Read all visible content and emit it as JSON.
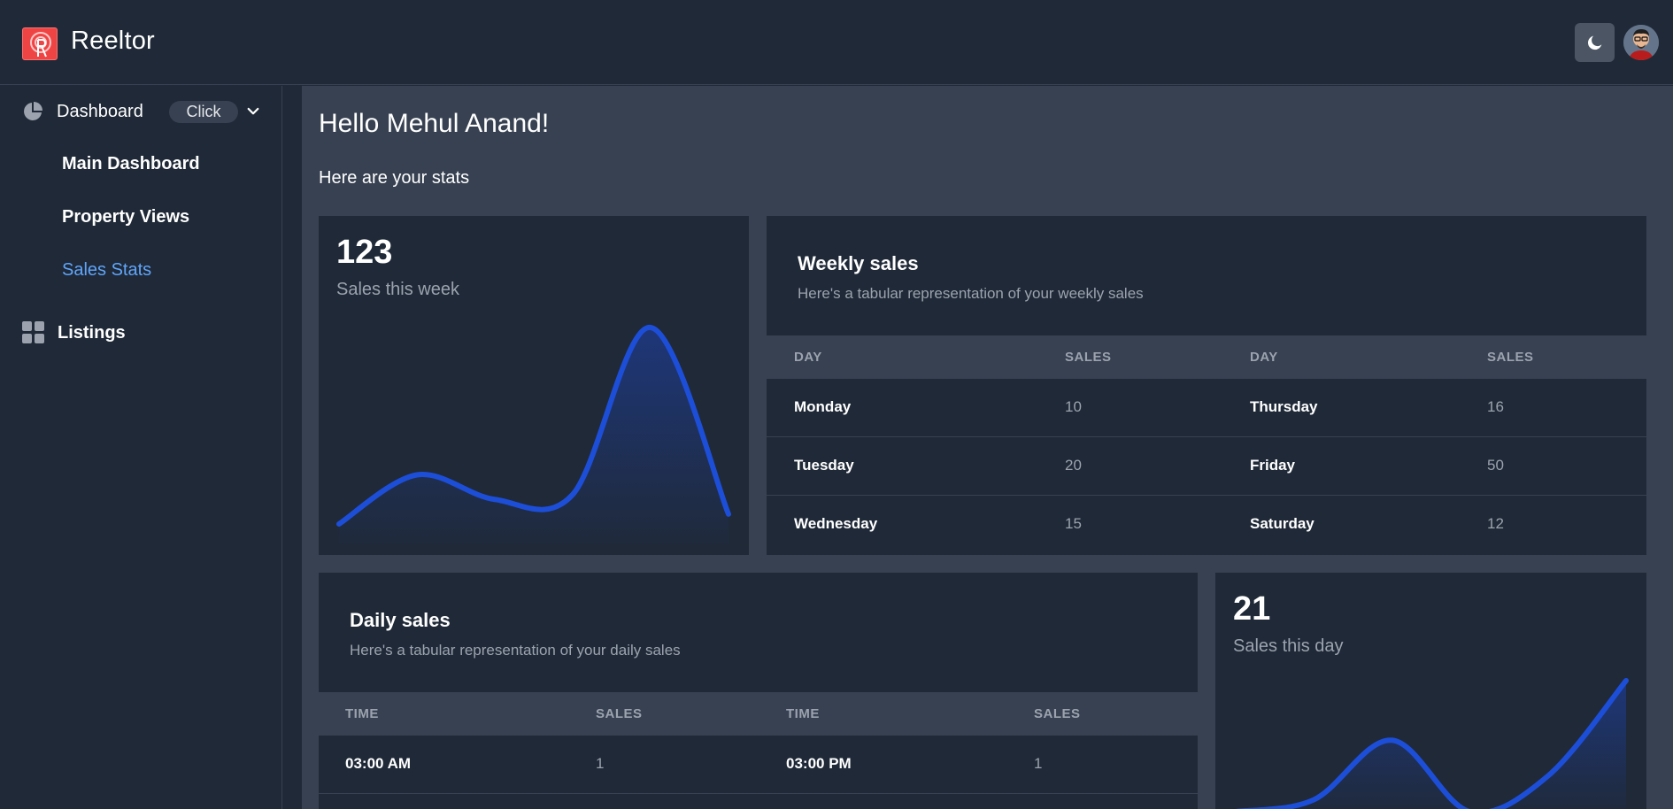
{
  "app": {
    "title": "Reeltor"
  },
  "theme": {
    "accent": "#60a5fa",
    "chart_line": "#1d4ed8",
    "logo_red": "#ef4444"
  },
  "sidebar": {
    "dashboard": {
      "label": "Dashboard",
      "badge": "Click"
    },
    "items": [
      {
        "label": "Main Dashboard",
        "active": false
      },
      {
        "label": "Property Views",
        "active": false
      },
      {
        "label": "Sales Stats",
        "active": true
      }
    ],
    "listings": {
      "label": "Listings"
    }
  },
  "main": {
    "greeting": "Hello Mehul Anand!",
    "subtitle": "Here are your stats"
  },
  "weekly_stat": {
    "value": "123",
    "label": "Sales this week"
  },
  "weekly_table": {
    "title": "Weekly sales",
    "description": "Here's a tabular representation of your weekly sales",
    "headers": [
      "DAY",
      "SALES",
      "DAY",
      "SALES"
    ],
    "rows": [
      [
        "Monday",
        "10",
        "Thursday",
        "16"
      ],
      [
        "Tuesday",
        "20",
        "Friday",
        "50"
      ],
      [
        "Wednesday",
        "15",
        "Saturday",
        "12"
      ]
    ]
  },
  "daily_table": {
    "title": "Daily sales",
    "description": "Here's a tabular representation of your daily sales",
    "headers": [
      "TIME",
      "SALES",
      "TIME",
      "SALES"
    ],
    "rows": [
      [
        "03:00 AM",
        "1",
        "03:00 PM",
        "1"
      ]
    ]
  },
  "daily_stat": {
    "value": "21",
    "label": "Sales this day"
  },
  "chart_data": [
    {
      "type": "area",
      "series": [
        {
          "values": [
            10,
            20,
            15,
            16,
            50,
            12
          ]
        }
      ],
      "x": [
        "Monday",
        "Tuesday",
        "Wednesday",
        "Thursday",
        "Friday",
        "Saturday"
      ],
      "title": "",
      "xlabel": "",
      "ylabel": "",
      "grid": false
    },
    {
      "type": "area",
      "series": [
        {
          "values": [
            0,
            1,
            6,
            0,
            3,
            11
          ]
        }
      ],
      "title": "",
      "xlabel": "",
      "ylabel": "",
      "grid": false
    }
  ]
}
